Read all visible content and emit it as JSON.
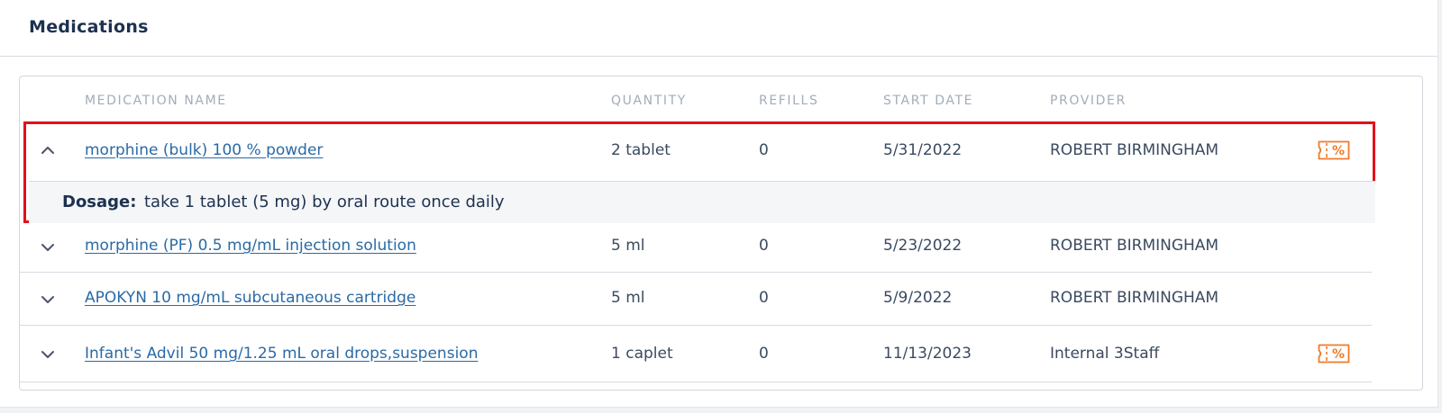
{
  "panel": {
    "title": "Medications"
  },
  "table": {
    "headers": {
      "name": "MEDICATION NAME",
      "quantity": "QUANTITY",
      "refills": "REFILLS",
      "start_date": "START DATE",
      "provider": "PROVIDER"
    },
    "rows": [
      {
        "name": "morphine (bulk) 100 % powder",
        "quantity": "2 tablet",
        "refills": "0",
        "start_date": "5/31/2022",
        "provider": "ROBERT BIRMINGHAM",
        "expanded": true,
        "has_coupon": true,
        "dosage_label": "Dosage:",
        "dosage_text": "take 1 tablet (5 mg) by oral route once daily"
      },
      {
        "name": "morphine (PF) 0.5 mg/mL injection solution",
        "quantity": "5 ml",
        "refills": "0",
        "start_date": "5/23/2022",
        "provider": "ROBERT BIRMINGHAM",
        "expanded": false,
        "has_coupon": false
      },
      {
        "name": "APOKYN 10 mg/mL subcutaneous cartridge",
        "quantity": "5 ml",
        "refills": "0",
        "start_date": "5/9/2022",
        "provider": "ROBERT BIRMINGHAM",
        "expanded": false,
        "has_coupon": false
      },
      {
        "name": "Infant's Advil 50 mg/1.25 mL oral drops,suspension",
        "quantity": "1 caplet",
        "refills": "0",
        "start_date": "11/13/2023",
        "provider": "Internal 3Staff",
        "expanded": false,
        "has_coupon": true
      }
    ]
  },
  "icons": {
    "collapse": "chevron-up-icon",
    "expand": "chevron-down-icon",
    "coupon": "coupon-percent-icon"
  },
  "colors": {
    "link": "#2a6aa5",
    "highlight_border": "#e3101a",
    "coupon": "#f07a2a",
    "header_text": "#a3acb9",
    "title": "#1d3150"
  }
}
